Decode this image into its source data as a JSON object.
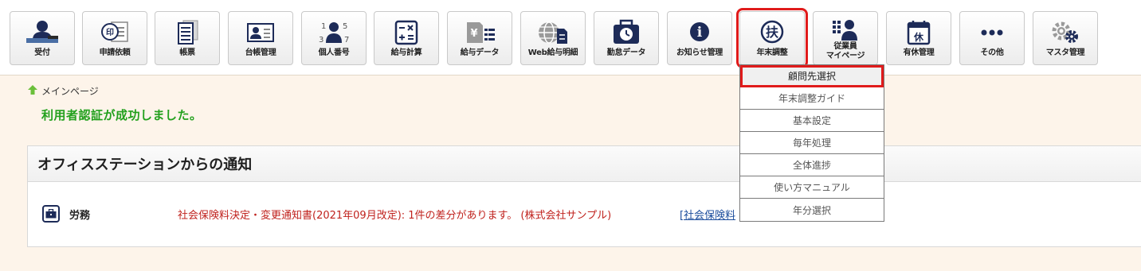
{
  "toolbar": {
    "buttons": [
      {
        "label": "受付",
        "icon": "reception-icon"
      },
      {
        "label": "申請依頼",
        "icon": "application-stamp-icon"
      },
      {
        "label": "帳票",
        "icon": "forms-icon"
      },
      {
        "label": "台帳管理",
        "icon": "ledger-icon"
      },
      {
        "label": "個人番号",
        "icon": "personal-number-icon"
      },
      {
        "label": "給与計算",
        "icon": "calculator-icon"
      },
      {
        "label": "給与データ",
        "icon": "payroll-data-icon"
      },
      {
        "label": "Web給与明細",
        "icon": "web-payslip-icon"
      },
      {
        "label": "勤怠データ",
        "icon": "attendance-icon"
      },
      {
        "label": "お知らせ管理",
        "icon": "info-icon"
      },
      {
        "label": "年末調整",
        "icon": "year-end-adjustment-icon"
      },
      {
        "label": "従業員\nマイページ",
        "icon": "employee-mypage-icon"
      },
      {
        "label": "有休管理",
        "icon": "paid-leave-icon"
      },
      {
        "label": "その他",
        "icon": "more-icon"
      },
      {
        "label": "マスタ管理",
        "icon": "settings-gears-icon"
      }
    ],
    "icon_glyphs": {
      "stamp": "印",
      "calc": "−×\n+=",
      "yen": "¥",
      "kyu": "休",
      "info": "i",
      "fu": "扶",
      "dots": "•••",
      "digits": [
        "1",
        "5",
        "3",
        "7"
      ]
    }
  },
  "breadcrumb": {
    "label": "メインページ",
    "icon": "home-arrow-icon"
  },
  "message": {
    "success": "利用者認証が成功しました。"
  },
  "notices": {
    "title": "オフィスステーションからの通知",
    "rows": [
      {
        "category": "労務",
        "icon": "briefcase-icon",
        "text": "社会保険料決定・変更通知書(2021年09月改定): 1件の差分があります。 (株式会社サンプル)",
        "link": "[社会保険料"
      }
    ]
  },
  "dropdown": {
    "items": [
      "顧問先選択",
      "年末調整ガイド",
      "基本設定",
      "毎年処理",
      "全体進捗",
      "使い方マニュアル",
      "年分選択"
    ],
    "active": "顧問先選択"
  },
  "colors": {
    "highlight": "#e01b1b",
    "success": "#22a01d",
    "notice_text": "#c0221d",
    "icon_navy": "#1d2b58"
  }
}
